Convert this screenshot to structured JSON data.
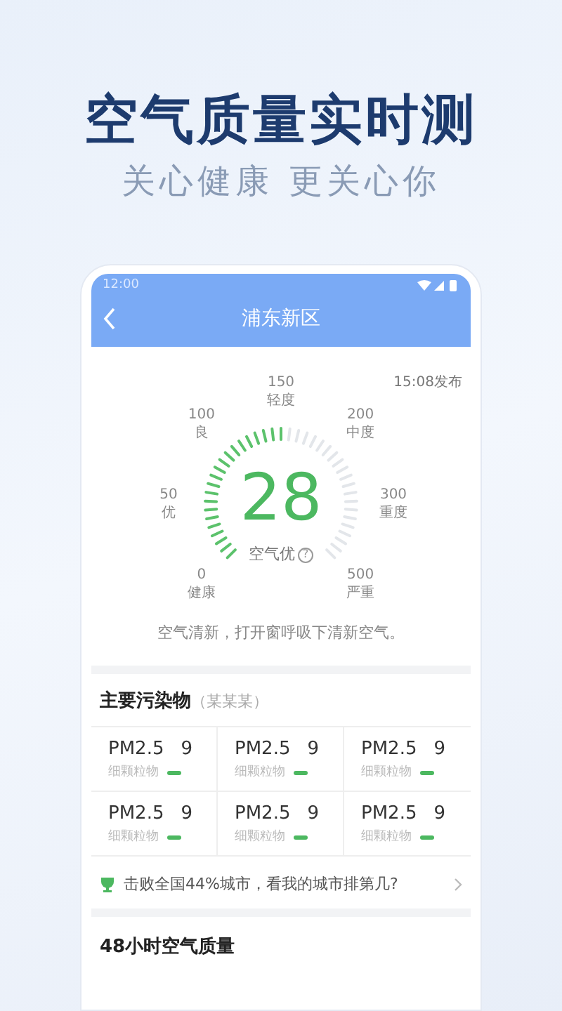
{
  "headline": "空气质量实时测",
  "tagline": "关心健康 更关心你",
  "status_bar": {
    "time": "12:00"
  },
  "header": {
    "title": "浦东新区"
  },
  "gauge": {
    "published": "15:08发布",
    "value": "28",
    "level": 0.5,
    "quality": "空气优",
    "help": "?",
    "scale": [
      {
        "value": "0",
        "label": "健康"
      },
      {
        "value": "50",
        "label": "优"
      },
      {
        "value": "100",
        "label": "良"
      },
      {
        "value": "150",
        "label": "轻度"
      },
      {
        "value": "200",
        "label": "中度"
      },
      {
        "value": "300",
        "label": "重度"
      },
      {
        "value": "500",
        "label": "严重"
      }
    ]
  },
  "advice": "空气清新，打开窗呼吸下清新空气。",
  "pollutants": {
    "title": "主要污染物",
    "subtitle": "（某某某）",
    "items": [
      {
        "name": "PM2.5",
        "value": "9",
        "desc": "细颗粒物",
        "color": "#4cb860"
      },
      {
        "name": "PM2.5",
        "value": "9",
        "desc": "细颗粒物",
        "color": "#4cb860"
      },
      {
        "name": "PM2.5",
        "value": "9",
        "desc": "细颗粒物",
        "color": "#4cb860"
      },
      {
        "name": "PM2.5",
        "value": "9",
        "desc": "细颗粒物",
        "color": "#4cb860"
      },
      {
        "name": "PM2.5",
        "value": "9",
        "desc": "细颗粒物",
        "color": "#4cb860"
      },
      {
        "name": "PM2.5",
        "value": "9",
        "desc": "细颗粒物",
        "color": "#4cb860"
      }
    ]
  },
  "ranking": {
    "text": "击败全国44%城市，看我的城市排第几?"
  },
  "forecast": {
    "title": "48小时空气质量"
  }
}
